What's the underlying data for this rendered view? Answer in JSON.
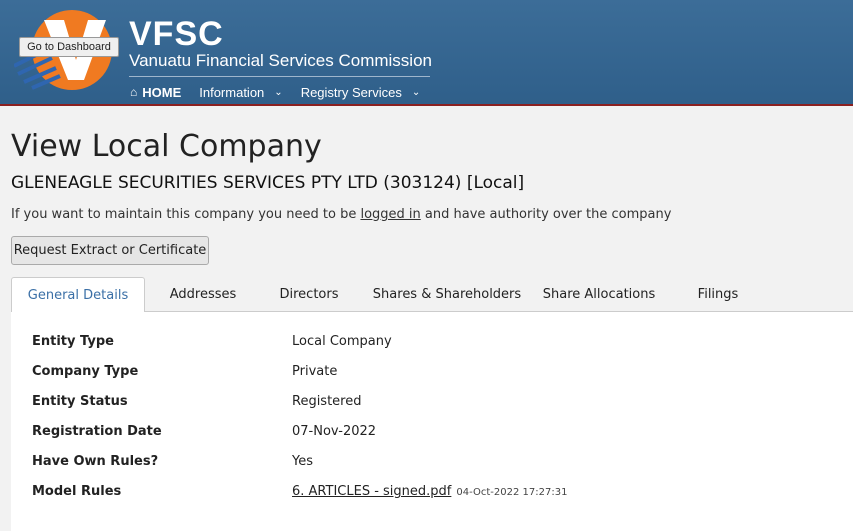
{
  "header": {
    "brand": "VFSC",
    "subtitle": "Vanuatu Financial Services Commission",
    "tooltip": "Go to Dashboard",
    "nav": [
      {
        "label": "HOME",
        "icon": "home-icon"
      },
      {
        "label": "Information"
      },
      {
        "label": "Registry Services"
      }
    ],
    "colors": {
      "bar": "#2f5f8a",
      "accent_orange": "#f07a21",
      "underline": "#8b2020"
    }
  },
  "page": {
    "title": "View Local Company",
    "company": "GLENEAGLE SECURITIES SERVICES PTY LTD (303124) [Local]",
    "maintain_before": "If you want to maintain this company you need to be ",
    "maintain_link": "logged in",
    "maintain_after": " and have authority over the company",
    "request_button": "Request Extract or Certificate"
  },
  "tabs": [
    {
      "label": "General Details",
      "active": true
    },
    {
      "label": "Addresses"
    },
    {
      "label": "Directors"
    },
    {
      "label": "Shares & Shareholders"
    },
    {
      "label": "Share Allocations"
    },
    {
      "label": "Filings"
    }
  ],
  "details": [
    {
      "label": "Entity Type",
      "value": "Local Company"
    },
    {
      "label": "Company Type",
      "value": "Private"
    },
    {
      "label": "Entity Status",
      "value": "Registered"
    },
    {
      "label": "Registration Date",
      "value": "07-Nov-2022"
    },
    {
      "label": "Have Own Rules?",
      "value": "Yes"
    },
    {
      "label": "Model Rules",
      "link": "6. ARTICLES - signed.pdf",
      "timestamp": "04-Oct-2022 17:27:31"
    }
  ]
}
